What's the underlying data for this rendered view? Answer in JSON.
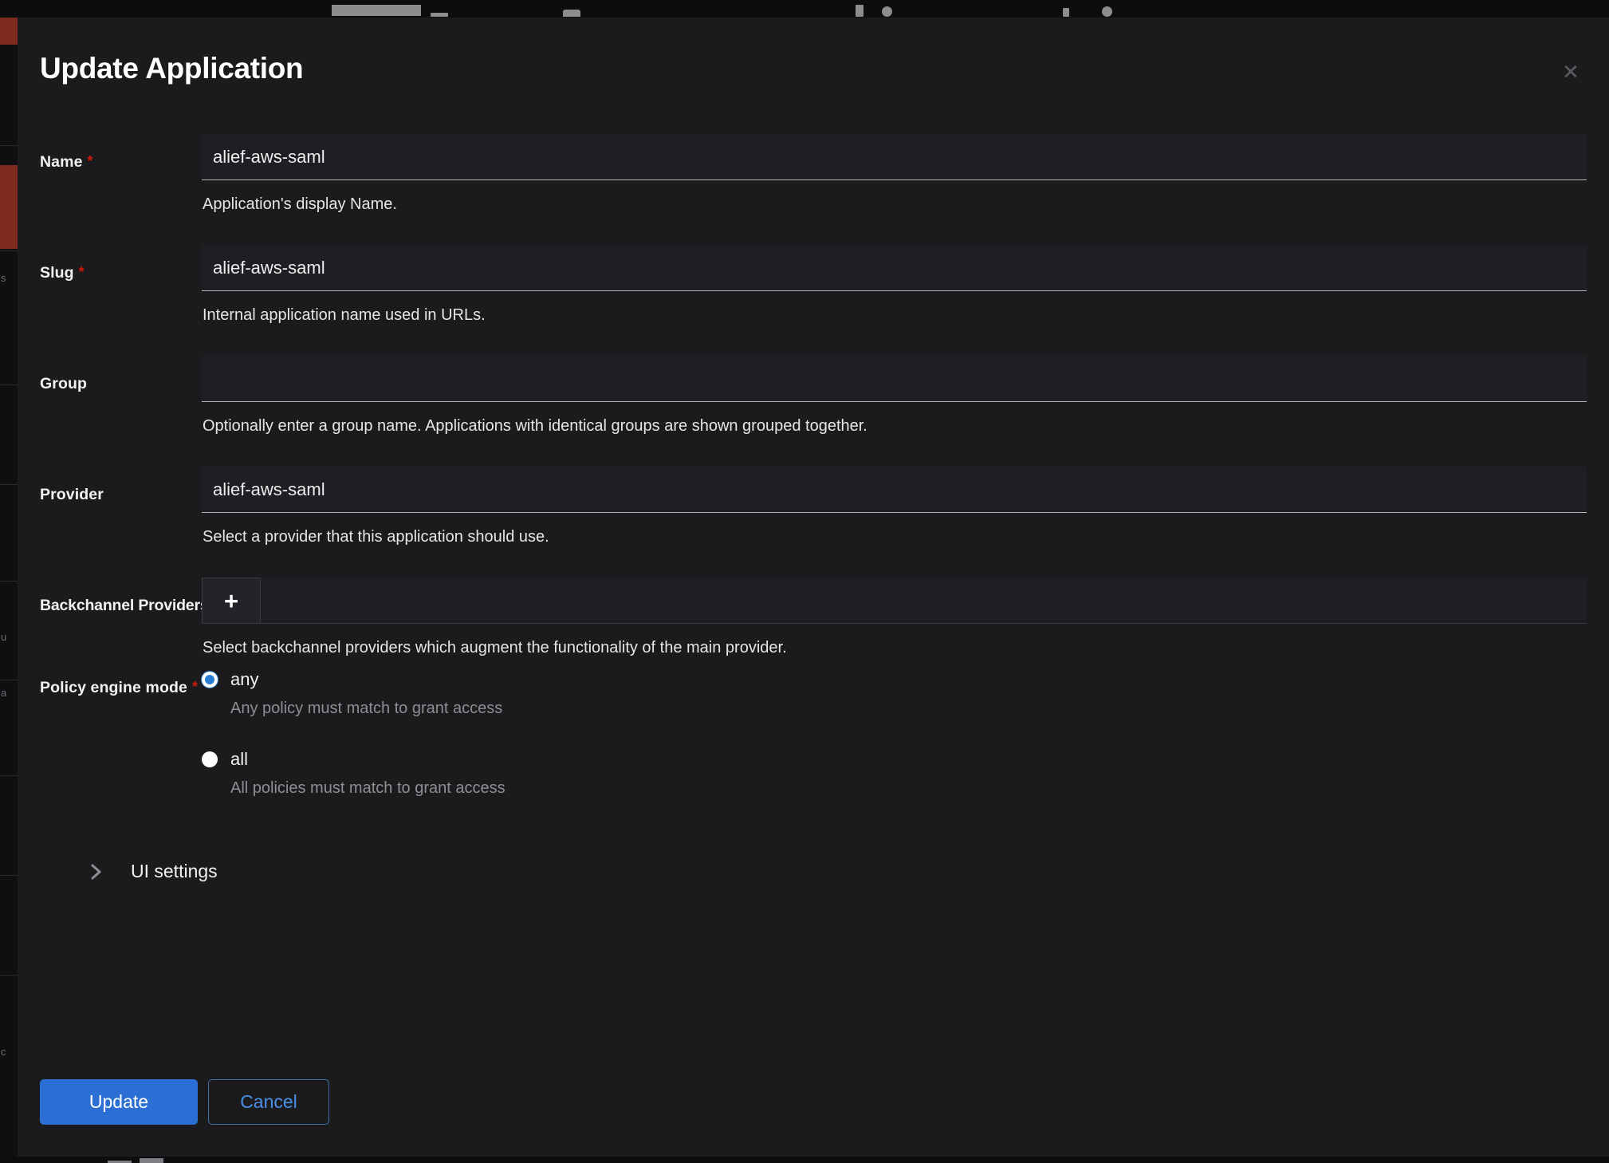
{
  "background": {
    "rail_labels": [
      "s",
      "u",
      "a",
      "c"
    ],
    "accent_color": "#7d2b1c"
  },
  "modal": {
    "title": "Update Application",
    "close_icon": "close-icon",
    "fields": {
      "name": {
        "label": "Name",
        "required": true,
        "value": "alief-aws-saml",
        "placeholder": "",
        "hint": "Application's display Name."
      },
      "slug": {
        "label": "Slug",
        "required": true,
        "value": "alief-aws-saml",
        "placeholder": "",
        "hint": "Internal application name used in URLs."
      },
      "group": {
        "label": "Group",
        "required": false,
        "value": "",
        "placeholder": "",
        "hint": "Optionally enter a group name. Applications with identical groups are shown grouped together."
      },
      "provider": {
        "label": "Provider",
        "required": false,
        "value": "alief-aws-saml",
        "placeholder": "",
        "hint": "Select a provider that this application should use."
      },
      "backchannel": {
        "label": "Backchannel Providers",
        "required": false,
        "add_icon": "plus-icon",
        "hint": "Select backchannel providers which augment the functionality of the main provider."
      },
      "policy_engine_mode": {
        "label": "Policy engine mode",
        "required": true,
        "selected": "any",
        "options": [
          {
            "value": "any",
            "label": "any",
            "description": "Any policy must match to grant access",
            "checked": true
          },
          {
            "value": "all",
            "label": "all",
            "description": "All policies must match to grant access",
            "checked": false
          }
        ]
      }
    },
    "expander": {
      "label": "UI settings",
      "icon": "chevron-right-icon",
      "expanded": false
    },
    "footer": {
      "submit_label": "Update",
      "cancel_label": "Cancel",
      "submit_color": "#2b6fd4",
      "cancel_color": "#4a90e8"
    }
  }
}
